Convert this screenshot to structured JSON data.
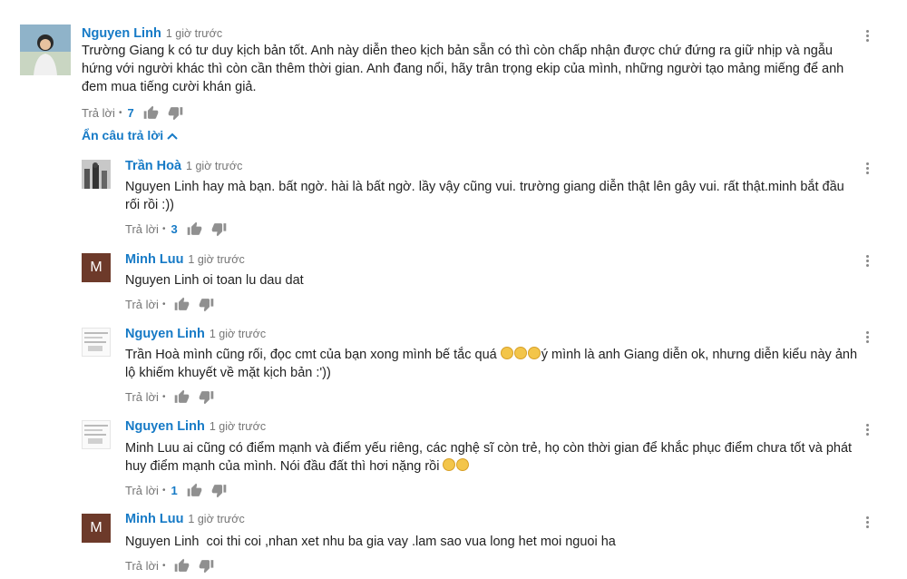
{
  "labels": {
    "reply": "Trả lời",
    "hide_replies": "Ẩn câu trả lời"
  },
  "comment": {
    "author": "Nguyen Linh",
    "time": "1 giờ trước",
    "text": "Trường Giang k có tư duy kịch bản tốt. Anh này diễn theo kịch bản sẵn có thì còn chấp nhận được chứ đứng ra giữ nhịp và ngẫu hứng với người khác thì còn cần thêm thời gian. Anh đang nổi, hãy trân trọng ekip của mình, những người tạo mảng miếng để anh đem mua tiếng cười khán giả.",
    "likes": "7"
  },
  "replies": [
    {
      "author": "Trần Hoà",
      "time": "1 giờ trước",
      "text": "Nguyen Linh hay mà bạn. bất ngờ. hài là bất ngờ. lầy vậy cũng vui. trường giang diễn thật lên gây vui. rất thật.minh bắt đầu rối rồi :))",
      "likes": "3",
      "avatar_letter": ""
    },
    {
      "author": "Minh Luu",
      "time": "1 giờ trước",
      "text": "Nguyen Linh oi toan lu dau dat",
      "likes": "",
      "avatar_letter": "M"
    },
    {
      "author": "Nguyen Linh",
      "time": "1 giờ trước",
      "text_a": "Trần Hoà mình cũng rối, đọc cmt của bạn xong mình bế tắc quá ",
      "text_b": "ý mình là anh Giang diễn ok, nhưng diễn kiểu này ảnh lộ khiếm khuyết về mặt kịch bản :'))",
      "likes": "",
      "avatar_letter": ""
    },
    {
      "author": "Nguyen Linh",
      "time": "1 giờ trước",
      "text": "Minh Luu ai cũng có điểm mạnh và điểm yếu riêng, các nghệ sĩ còn trẻ, họ còn thời gian để khắc phục điểm chưa tốt và phát huy điểm mạnh của mình. Nói đầu đất thì hơi nặng rồi ",
      "likes": "1",
      "avatar_letter": ""
    },
    {
      "author": "Minh Luu",
      "time": "1 giờ trước",
      "text": "Nguyen Linh  coi thi coi ,nhan xet nhu ba gia vay .lam sao vua long het moi nguoi ha",
      "likes": "",
      "avatar_letter": "M"
    }
  ]
}
